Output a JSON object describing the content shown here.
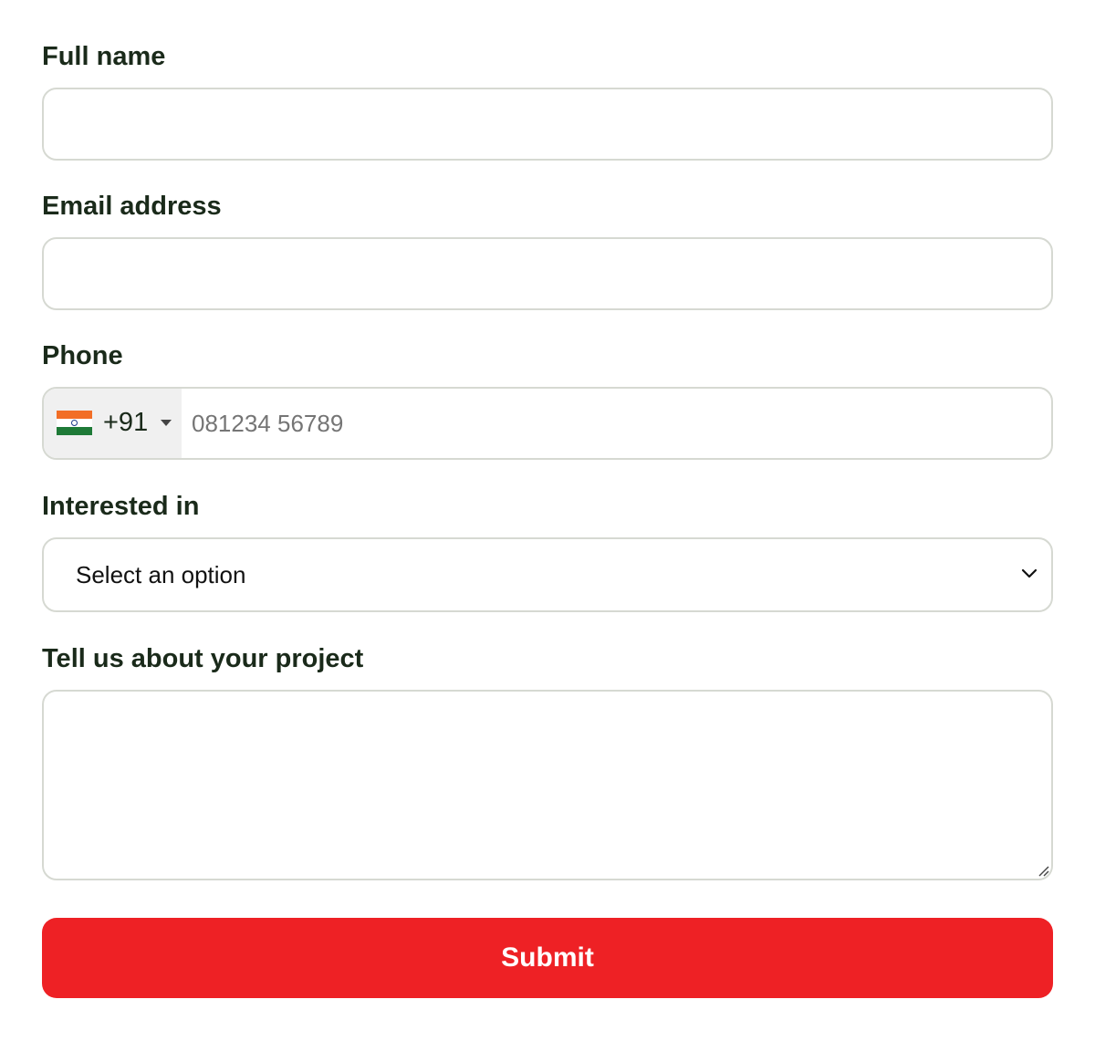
{
  "form": {
    "full_name": {
      "label": "Full name",
      "value": "",
      "placeholder": ""
    },
    "email": {
      "label": "Email address",
      "value": "",
      "placeholder": ""
    },
    "phone": {
      "label": "Phone",
      "country_flag_icon": "india-flag-icon",
      "country_code": "+91",
      "value": "",
      "placeholder": "081234 56789"
    },
    "interest": {
      "label": "Interested in",
      "selected": "Select an option",
      "dropdown_icon": "chevron-down-icon"
    },
    "project": {
      "label": "Tell us about your project",
      "value": "",
      "placeholder": ""
    },
    "submit_label": "Submit"
  },
  "colors": {
    "submit_bg": "#ee2125",
    "label_text": "#1a2a1a",
    "field_border": "#d6d9d2",
    "country_bg": "#f0f0f0",
    "flag_saffron": "#f26e26",
    "flag_white": "#ffffff",
    "flag_green": "#1e7a37",
    "flag_chakra": "#1d3a8a"
  }
}
